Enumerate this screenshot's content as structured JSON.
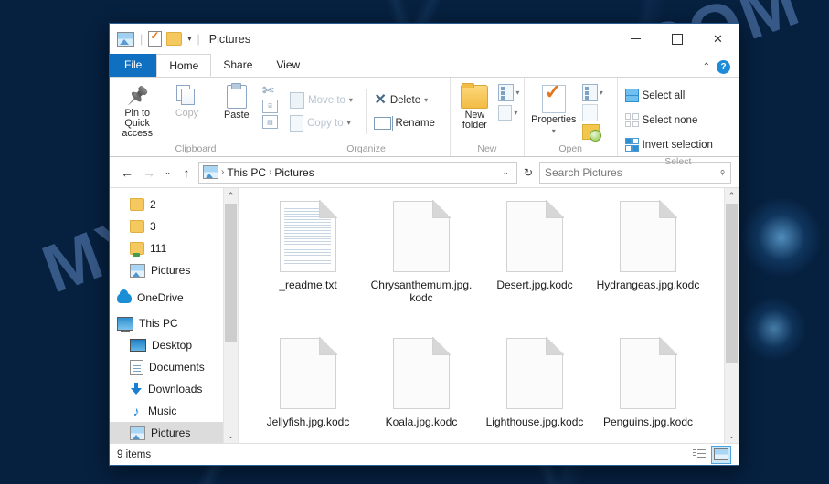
{
  "desktop": {
    "watermark": "MYANTISPYWARE.COM"
  },
  "window": {
    "title": "Pictures",
    "quick_access": {
      "properties_icon": "properties-checkmark-icon",
      "new_folder_icon": "folder-icon",
      "customize_icon": "chevron-down-icon",
      "window_icon": "pictures-folder-icon"
    },
    "controls": {
      "minimize": "minimize-icon",
      "maximize": "maximize-icon",
      "close": "close-icon",
      "collapse_ribbon": "chevron-up-icon",
      "help": "?"
    },
    "tabs": [
      {
        "label": "File",
        "state": "file"
      },
      {
        "label": "Home",
        "state": "active"
      },
      {
        "label": "Share",
        "state": "normal"
      },
      {
        "label": "View",
        "state": "normal"
      }
    ]
  },
  "ribbon": {
    "groups": [
      {
        "label": "Clipboard",
        "big": [
          {
            "label": "Pin to Quick access",
            "icon": "pin-icon",
            "dim": false
          },
          {
            "label": "Copy",
            "icon": "copy-icon",
            "dim": true
          },
          {
            "label": "Paste",
            "icon": "paste-icon",
            "dim": false
          }
        ],
        "small": [
          {
            "label": "Cut",
            "icon": "scissors-icon"
          },
          {
            "label": "Copy path",
            "icon": "copy-path-icon"
          },
          {
            "label": "Paste shortcut",
            "icon": "paste-shortcut-icon"
          }
        ]
      },
      {
        "label": "Organize",
        "items": [
          {
            "label": "Move to",
            "icon": "move-to-icon",
            "caret": true
          },
          {
            "label": "Delete",
            "icon": "delete-x-icon",
            "caret": true
          },
          {
            "label": "Copy to",
            "icon": "copy-to-icon",
            "caret": true
          },
          {
            "label": "Rename",
            "icon": "rename-icon",
            "caret": false
          }
        ]
      },
      {
        "label": "New",
        "big": [
          {
            "label": "New folder",
            "icon": "new-folder-icon"
          }
        ],
        "small": [
          {
            "label": "New item",
            "icon": "new-item-icon"
          },
          {
            "label": "Easy access",
            "icon": "easy-access-icon"
          }
        ]
      },
      {
        "label": "Open",
        "big": [
          {
            "label": "Properties",
            "icon": "properties-icon"
          }
        ],
        "small": [
          {
            "label": "Open",
            "icon": "open-icon"
          },
          {
            "label": "Edit",
            "icon": "edit-icon"
          },
          {
            "label": "History",
            "icon": "history-icon"
          }
        ]
      },
      {
        "label": "Select",
        "items": [
          {
            "label": "Select all",
            "icon": "select-all-icon"
          },
          {
            "label": "Select none",
            "icon": "select-none-icon"
          },
          {
            "label": "Invert selection",
            "icon": "invert-selection-icon"
          }
        ]
      }
    ]
  },
  "navbar": {
    "back": "back-arrow-icon",
    "forward": "forward-arrow-icon",
    "recent": "chevron-down-icon",
    "up": "up-arrow-icon",
    "breadcrumb": [
      "This PC",
      "Pictures"
    ],
    "breadcrumb_icon": "pictures-folder-icon",
    "dropdown": "chevron-down-icon",
    "refresh": "refresh-icon",
    "search": {
      "placeholder": "Search Pictures",
      "value": "",
      "icon": "search-icon"
    }
  },
  "navpane": {
    "items": [
      {
        "label": "2",
        "icon": "folder-icon",
        "indent": 2,
        "selected": false
      },
      {
        "label": "3",
        "icon": "folder-icon",
        "indent": 2,
        "selected": false
      },
      {
        "label": "111",
        "icon": "folder-pinned-icon",
        "indent": 2,
        "selected": false
      },
      {
        "label": "Pictures",
        "icon": "pictures-icon",
        "indent": 2,
        "selected": false
      },
      {
        "label": "OneDrive",
        "icon": "onedrive-cloud-icon",
        "indent": 1,
        "selected": false
      },
      {
        "label": "This PC",
        "icon": "this-pc-icon",
        "indent": 1,
        "selected": false
      },
      {
        "label": "Desktop",
        "icon": "desktop-icon",
        "indent": 2,
        "selected": false
      },
      {
        "label": "Documents",
        "icon": "documents-icon",
        "indent": 2,
        "selected": false
      },
      {
        "label": "Downloads",
        "icon": "downloads-icon",
        "indent": 2,
        "selected": false
      },
      {
        "label": "Music",
        "icon": "music-icon",
        "indent": 2,
        "selected": false
      },
      {
        "label": "Pictures",
        "icon": "pictures-icon",
        "indent": 2,
        "selected": true
      }
    ]
  },
  "files": [
    {
      "name": "_readme.txt",
      "icon": "text-file-icon"
    },
    {
      "name": "Chrysanthemum.jpg.kodc",
      "icon": "blank-file-icon"
    },
    {
      "name": "Desert.jpg.kodc",
      "icon": "blank-file-icon"
    },
    {
      "name": "Hydrangeas.jpg.kodc",
      "icon": "blank-file-icon"
    },
    {
      "name": "Jellyfish.jpg.kodc",
      "icon": "blank-file-icon"
    },
    {
      "name": "Koala.jpg.kodc",
      "icon": "blank-file-icon"
    },
    {
      "name": "Lighthouse.jpg.kodc",
      "icon": "blank-file-icon"
    },
    {
      "name": "Penguins.jpg.kodc",
      "icon": "blank-file-icon"
    }
  ],
  "status": {
    "count": "9 items",
    "views": [
      {
        "name": "details-view",
        "active": false
      },
      {
        "name": "large-icons-view",
        "active": true
      }
    ]
  },
  "colors": {
    "accent": "#0f6fc0",
    "selection": "#cce8f7",
    "folder": "#f6c860"
  }
}
